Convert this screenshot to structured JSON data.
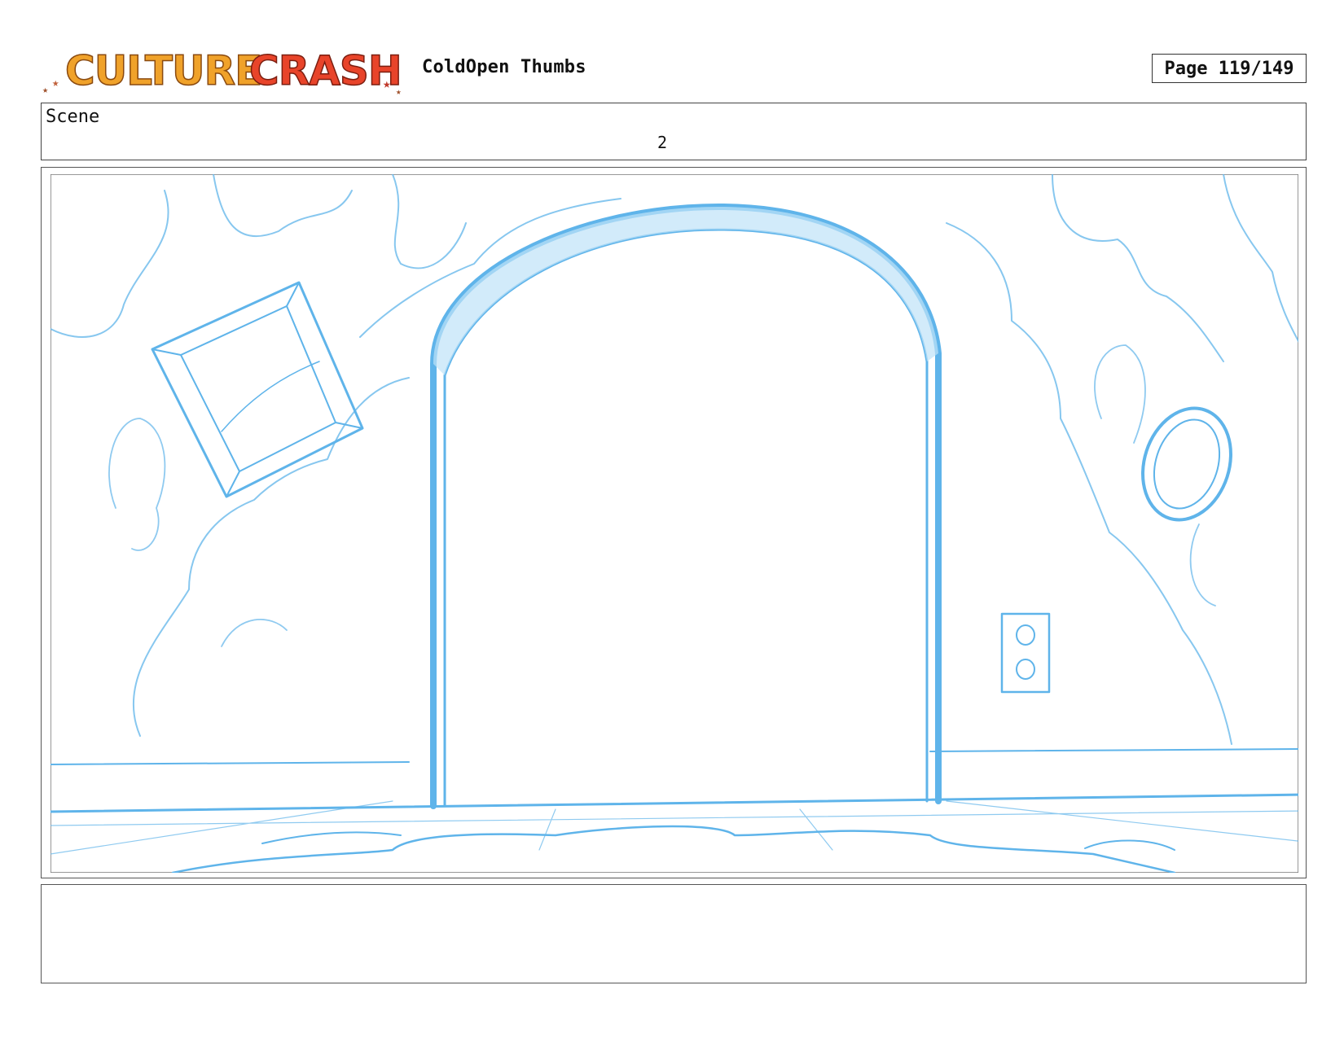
{
  "header": {
    "logo_text": "CULTURE CRASH",
    "title": "ColdOpen Thumbs",
    "page_indicator": "Page 119/149"
  },
  "scene": {
    "label": "Scene",
    "number": "2"
  },
  "panel": {
    "sketch_color": "#5fb4ea",
    "sketch_fill": "#bfe2f8"
  },
  "notes": {
    "text": ""
  }
}
